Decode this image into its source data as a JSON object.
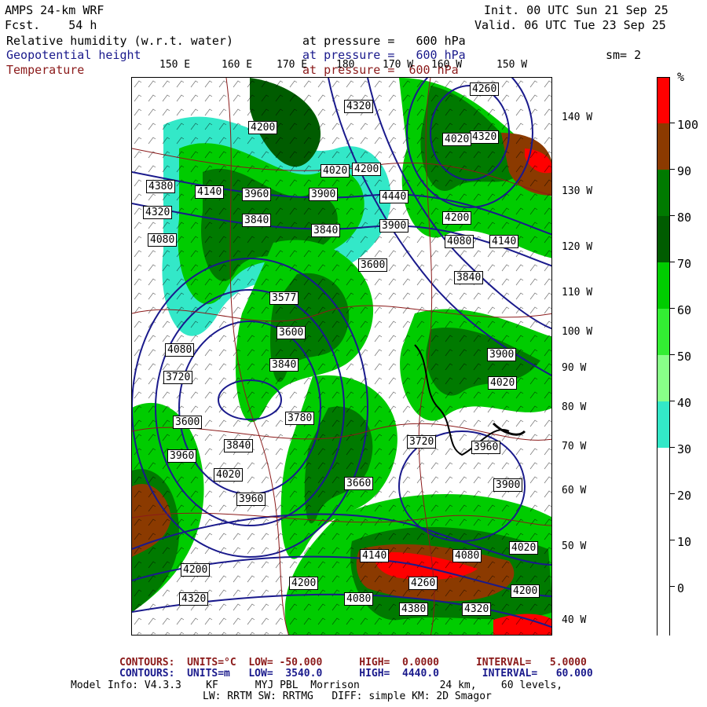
{
  "header": {
    "model": "AMPS 24-km WRF",
    "fcst": "Fcst.    54 h",
    "init": "Init. 00 UTC Sun 21 Sep 25",
    "valid": "Valid. 06 UTC Tue 23 Sep 25",
    "field1_name": "Relative humidity (w.r.t. water)",
    "field1_level": "at pressure =   600 hPa",
    "field2_name": "Geopotential height",
    "field2_level": "at pressure =   600 hPa",
    "smoothing": "sm= 2",
    "field3_name": "Temperature",
    "field3_level": "at pressure =  600 hPa"
  },
  "longitude_labels": [
    "150 E",
    "160 E",
    "170 E",
    "180",
    "170 W",
    "160 W",
    "150 W"
  ],
  "latitude_labels": [
    "140 W",
    "130 W",
    "120 W",
    "110 W",
    "100 W",
    "90 W",
    "80 W",
    "70 W",
    "60 W",
    "50 W",
    "40 W"
  ],
  "height_labels": [
    "4260",
    "4320",
    "4200",
    "4140",
    "4080",
    "4020",
    "3960",
    "3900",
    "3840",
    "3780",
    "3720",
    "3660",
    "3600",
    "3577",
    "4380",
    "4440"
  ],
  "colorbar": {
    "unit": "%",
    "labels": [
      "100",
      "90",
      "80",
      "70",
      "60",
      "50",
      "40",
      "30",
      "20",
      "10",
      "0"
    ],
    "colors": {
      "100": "#ff0000",
      "90": "#8b3a00",
      "80": "#007a00",
      "70": "#005c00",
      "60": "#00cc00",
      "50": "#33ee33",
      "40": "#88ff88",
      "30": "#33e8c8",
      "20": "#ffffff",
      "10": "#ffffff",
      "0": "#ffffff"
    }
  },
  "footer": {
    "temp_contours": "CONTOURS:  UNITS=°C  LOW= -50.000      HIGH=  0.0000      INTERVAL=   5.0000",
    "height_contours": "CONTOURS:  UNITS=m   LOW=  3540.0      HIGH=  4440.0       INTERVAL=   60.000",
    "model_info_1": "Model Info: V4.3.3    KF      MYJ PBL  Morrison             24 km,    60 levels,",
    "model_info_2": "LW: RRTM SW: RRTMG   DIFF: simple KM: 2D Smagor"
  }
}
